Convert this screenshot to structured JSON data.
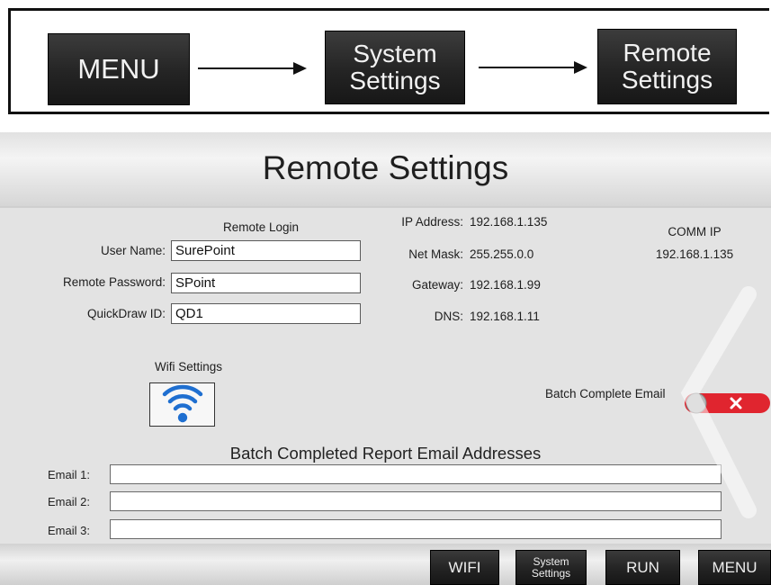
{
  "path": {
    "menu_label": "MENU",
    "system_settings_lines": [
      "System",
      "Settings"
    ],
    "remote_settings_lines": [
      "Remote",
      "Settings"
    ],
    "arrow_icon": "arrow-right-icon"
  },
  "screen": {
    "title": "Remote Settings",
    "remote_login": {
      "heading": "Remote Login",
      "user_name_label": "User Name:",
      "user_name_value": "SurePoint",
      "password_label": "Remote Password:",
      "password_value": "SPoint",
      "quickdraw_label": "QuickDraw ID:",
      "quickdraw_value": "QD1"
    },
    "network": {
      "ip_label": "IP Address:",
      "ip_value": "192.168.1.135",
      "mask_label": "Net Mask:",
      "mask_value": "255.255.0.0",
      "gateway_label": "Gateway:",
      "gateway_value": "192.168.1.99",
      "dns_label": "DNS:",
      "dns_value": "192.168.1.11"
    },
    "comm_ip": {
      "label": "COMM IP",
      "value": "192.168.1.135"
    },
    "wifi": {
      "label": "Wifi Settings",
      "icon": "wifi-icon"
    },
    "batch_email_toggle": {
      "label": "Batch Complete Email",
      "state": "off",
      "icon": "close-x-icon"
    },
    "email_section": {
      "title": "Batch Completed Report Email Addresses",
      "fields": [
        {
          "label": "Email 1:",
          "value": ""
        },
        {
          "label": "Email 2:",
          "value": ""
        },
        {
          "label": "Email 3:",
          "value": ""
        }
      ]
    },
    "footer_buttons": {
      "wifi": "WIFI",
      "system_settings_lines": [
        "System",
        "Settings"
      ],
      "run": "RUN",
      "menu": "MENU"
    }
  },
  "colors": {
    "button_dark": "#242424",
    "button_text": "#f2f2f2",
    "panel_bg": "#e3e3e3",
    "toggle_off_red": "#e0252f",
    "wifi_blue": "#1f6fd0"
  }
}
